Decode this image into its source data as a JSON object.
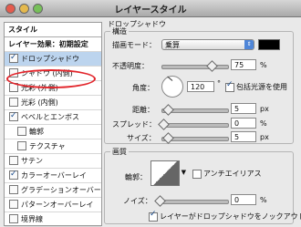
{
  "window": {
    "title": "レイヤースタイル"
  },
  "styles_list": {
    "header": "スタイル",
    "items": [
      {
        "label": "レイヤー効果：初期設定",
        "checkbox": false,
        "checked": false,
        "selected": false,
        "indent": 0
      },
      {
        "label": "ドロップシャドウ",
        "checkbox": true,
        "checked": true,
        "selected": true,
        "indent": 0
      },
      {
        "label": "シャドウ (内側)",
        "checkbox": true,
        "checked": false,
        "selected": false,
        "indent": 0
      },
      {
        "label": "光彩 (外側)",
        "checkbox": true,
        "checked": false,
        "selected": false,
        "indent": 0
      },
      {
        "label": "光彩 (内側)",
        "checkbox": true,
        "checked": false,
        "selected": false,
        "indent": 0
      },
      {
        "label": "ベベルとエンボス",
        "checkbox": true,
        "checked": true,
        "selected": false,
        "indent": 0
      },
      {
        "label": "輪郭",
        "checkbox": true,
        "checked": false,
        "selected": false,
        "indent": 1
      },
      {
        "label": "テクスチャ",
        "checkbox": true,
        "checked": false,
        "selected": false,
        "indent": 1
      },
      {
        "label": "サテン",
        "checkbox": true,
        "checked": false,
        "selected": false,
        "indent": 0
      },
      {
        "label": "カラーオーバーレイ",
        "checkbox": true,
        "checked": true,
        "selected": false,
        "indent": 0
      },
      {
        "label": "グラデーションオーバーレイ",
        "checkbox": true,
        "checked": false,
        "selected": false,
        "indent": 0
      },
      {
        "label": "パターンオーバーレイ",
        "checkbox": true,
        "checked": false,
        "selected": false,
        "indent": 0
      },
      {
        "label": "境界線",
        "checkbox": true,
        "checked": false,
        "selected": false,
        "indent": 0
      }
    ]
  },
  "drop_shadow": {
    "section_title": "ドロップシャドウ",
    "structure_title": "構造",
    "blend_mode_label": "描画モード：",
    "blend_mode_value": "乗算",
    "shadow_color": "#000000",
    "opacity_label": "不透明度：",
    "opacity_value": "75",
    "opacity_unit": "%",
    "opacity_fraction": 0.75,
    "angle_label": "角度：",
    "angle_value": "120",
    "angle_unit": "°",
    "global_light_label": "包括光源を使用",
    "global_light_checked": true,
    "distance_label": "距離：",
    "distance_value": "5",
    "distance_unit": "px",
    "spread_label": "スプレッド：",
    "spread_value": "0",
    "spread_unit": "%",
    "size_label": "サイズ：",
    "size_value": "5",
    "size_unit": "px",
    "quality_title": "画質",
    "contour_label": "輪郭：",
    "antialias_label": "アンチエイリアス",
    "antialias_checked": false,
    "noise_label": "ノイズ：",
    "noise_value": "0",
    "noise_unit": "%",
    "knockout_label": "レイヤーがドロップシャドウをノックアウト",
    "knockout_checked": true
  }
}
